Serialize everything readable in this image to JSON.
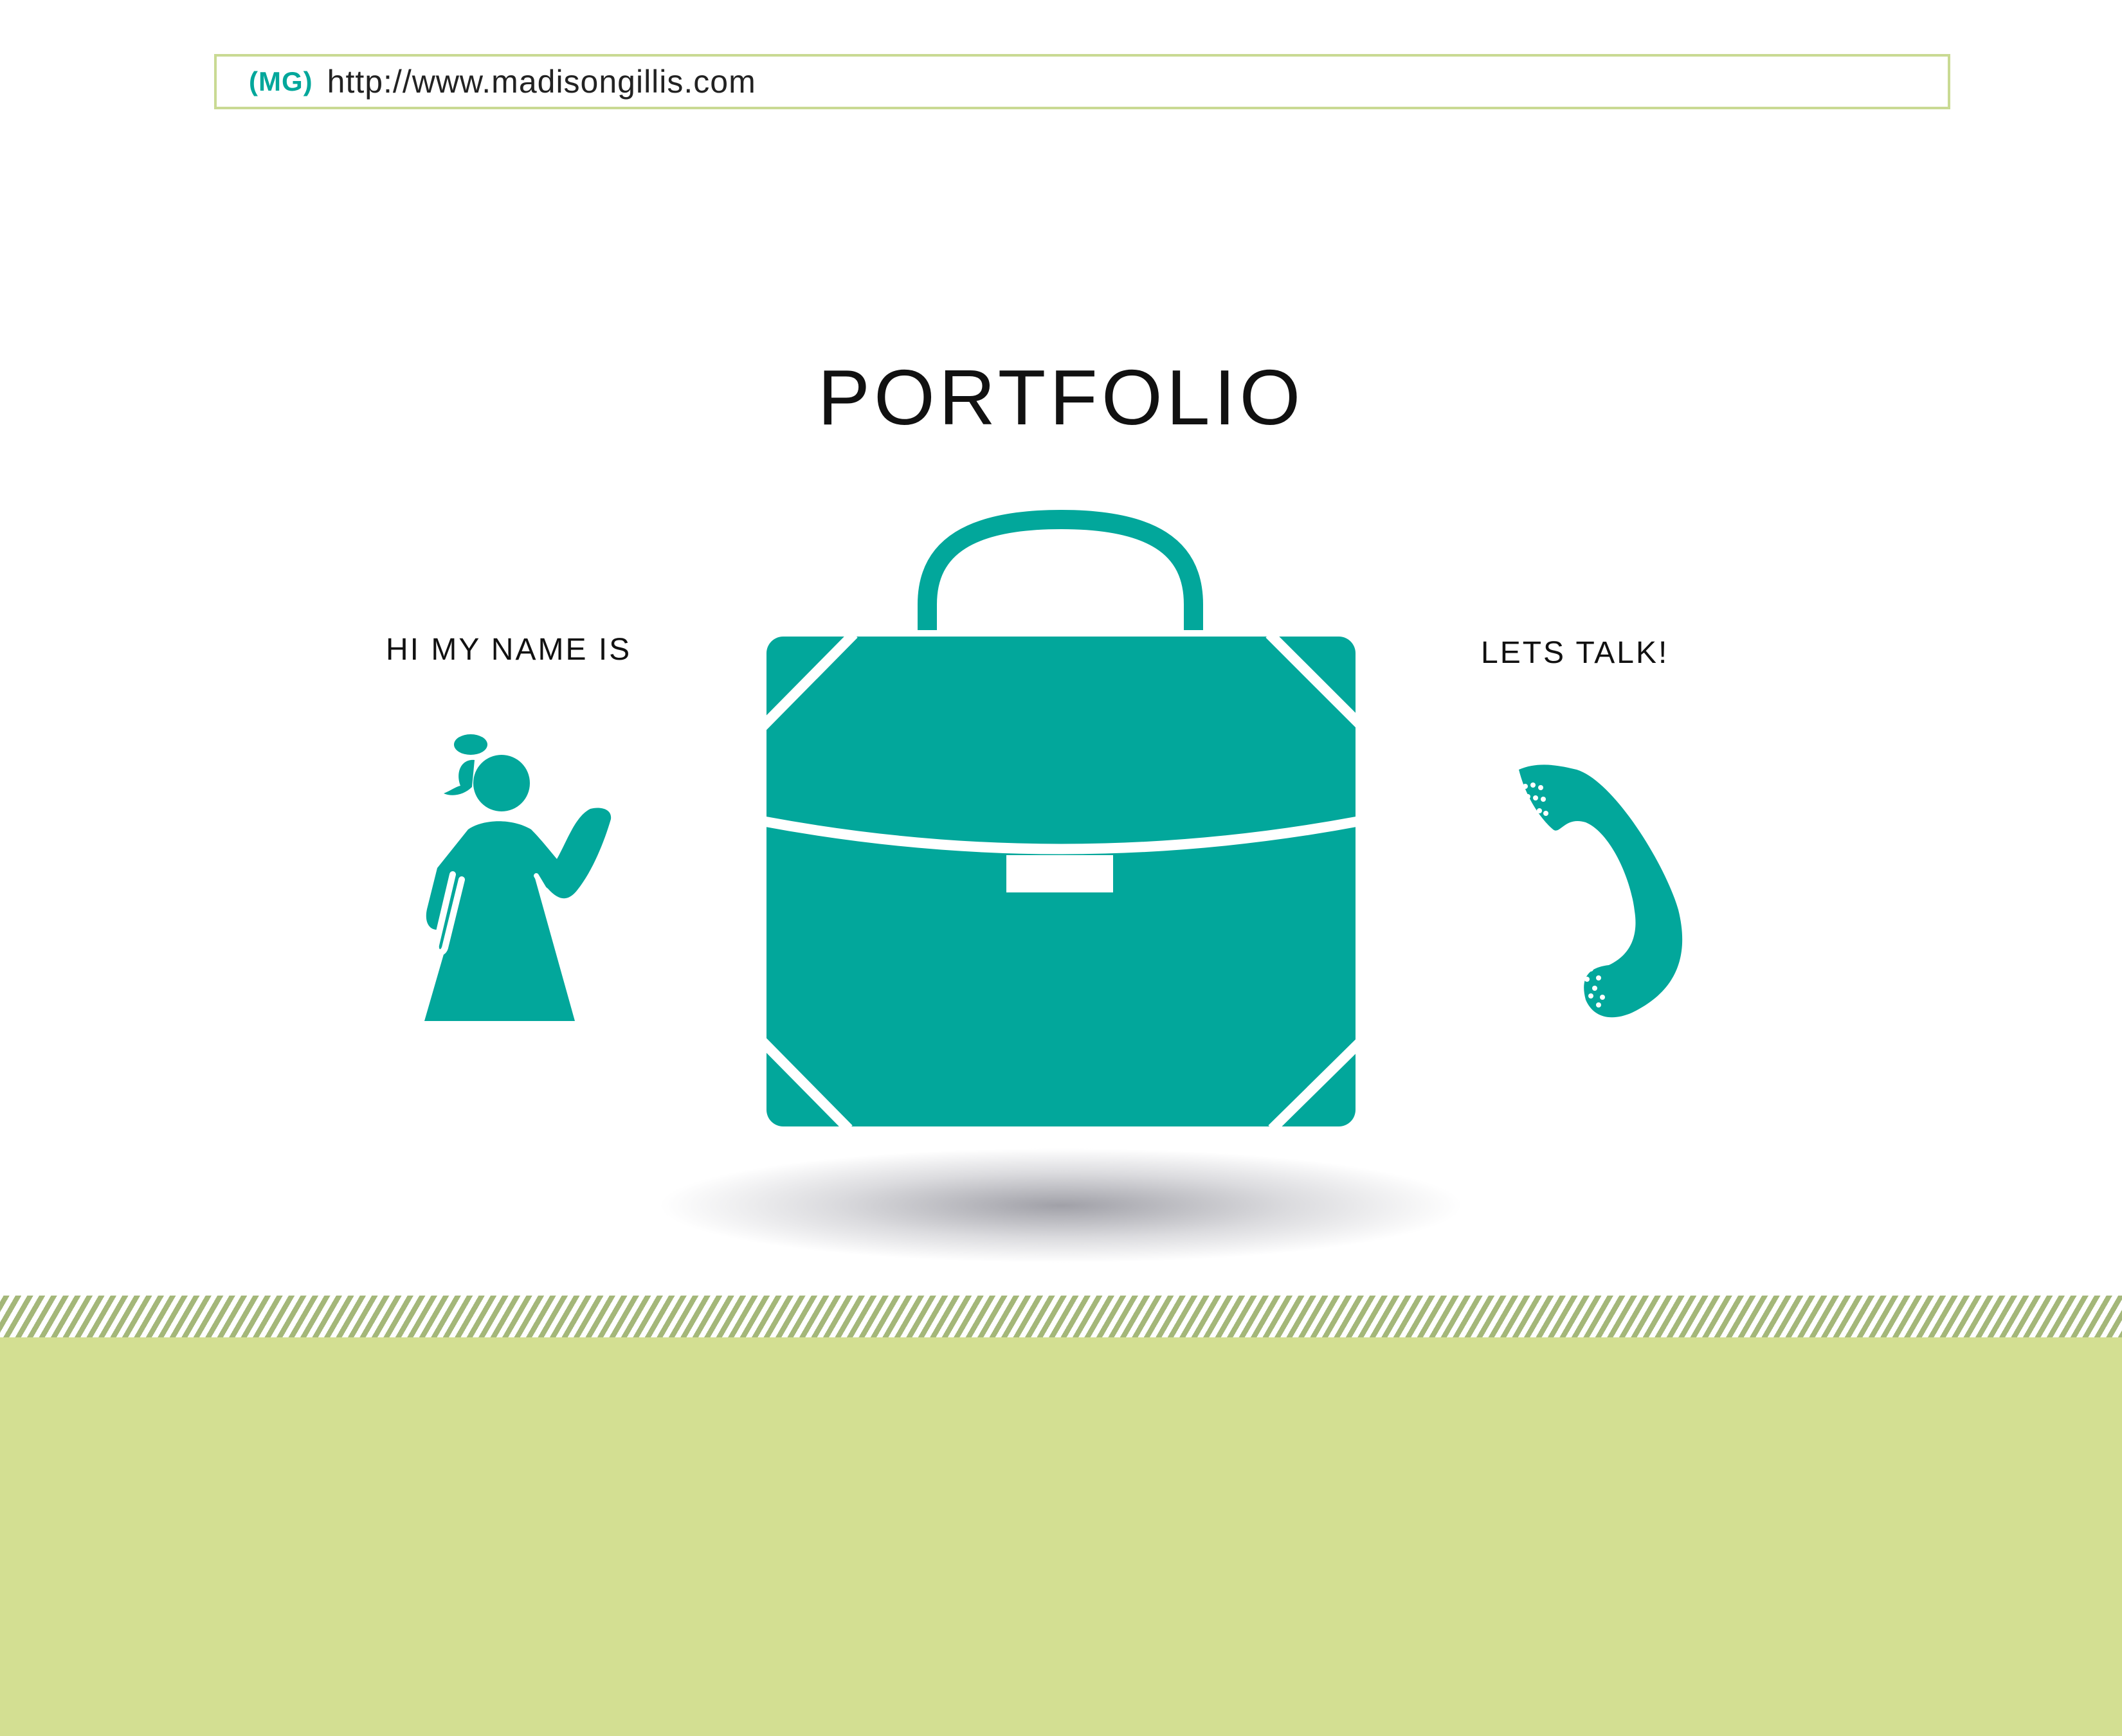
{
  "browser": {
    "logo": "(MG)",
    "url": "http://www.madisongillis.com"
  },
  "main": {
    "title": "PORTFOLIO",
    "left_label": "HI MY NAME IS",
    "right_label": "LETS TALK!"
  },
  "icons": {
    "about": "waving-girl-icon",
    "portfolio": "briefcase-icon",
    "contact": "phone-handset-icon"
  },
  "colors": {
    "accent": "#02a79b",
    "ground": "#d3df92",
    "stripes": "#a4b779",
    "frame": "#c9da93"
  }
}
